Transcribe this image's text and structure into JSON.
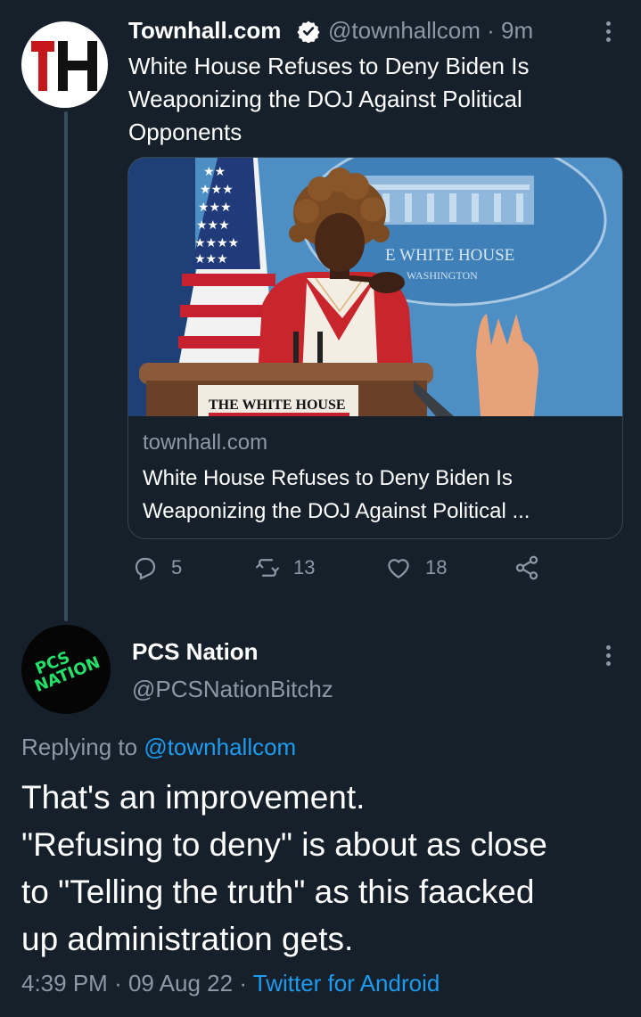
{
  "tweet1": {
    "display_name": "Townhall.com",
    "handle": "@townhallcom",
    "separator": "·",
    "time": "9m",
    "avatar_text": "TH",
    "text": "White House Refuses to Deny Biden Is Weaponizing the DOJ Against Political Opponents",
    "card": {
      "image_podium_label": "THE WHITE HOUSE",
      "image_seal_label": "E WHITE HOUSE",
      "image_seal_sub": "WASHINGTON",
      "domain": "townhall.com",
      "title_line1": "White House Refuses to Deny Biden Is",
      "title_line2": "Weaponizing the DOJ Against Political ..."
    },
    "actions": {
      "replies": "5",
      "retweets": "13",
      "likes": "18"
    }
  },
  "tweet2": {
    "display_name": "PCS Nation",
    "handle": "@PCSNationBitchz",
    "avatar_line1": "PCS",
    "avatar_line2": "NATION",
    "replying_prefix": "Replying to",
    "replying_handle": "@townhallcom",
    "text_lines": [
      "That's an improvement.",
      "\"Refusing to deny\" is about as close",
      "to \"Telling the truth\" as this faacked",
      "up administration gets."
    ],
    "time": "4:39 PM",
    "sep1": "·",
    "date": "09 Aug 22",
    "sep2": "·",
    "client": "Twitter for Android"
  },
  "colors": {
    "background": "#15202b",
    "secondary_text": "#8b98a5",
    "link": "#1d9bf0",
    "border": "#38444d"
  },
  "icons": [
    "more-icon",
    "verified-badge-icon",
    "reply-icon",
    "retweet-icon",
    "like-icon",
    "share-icon"
  ]
}
